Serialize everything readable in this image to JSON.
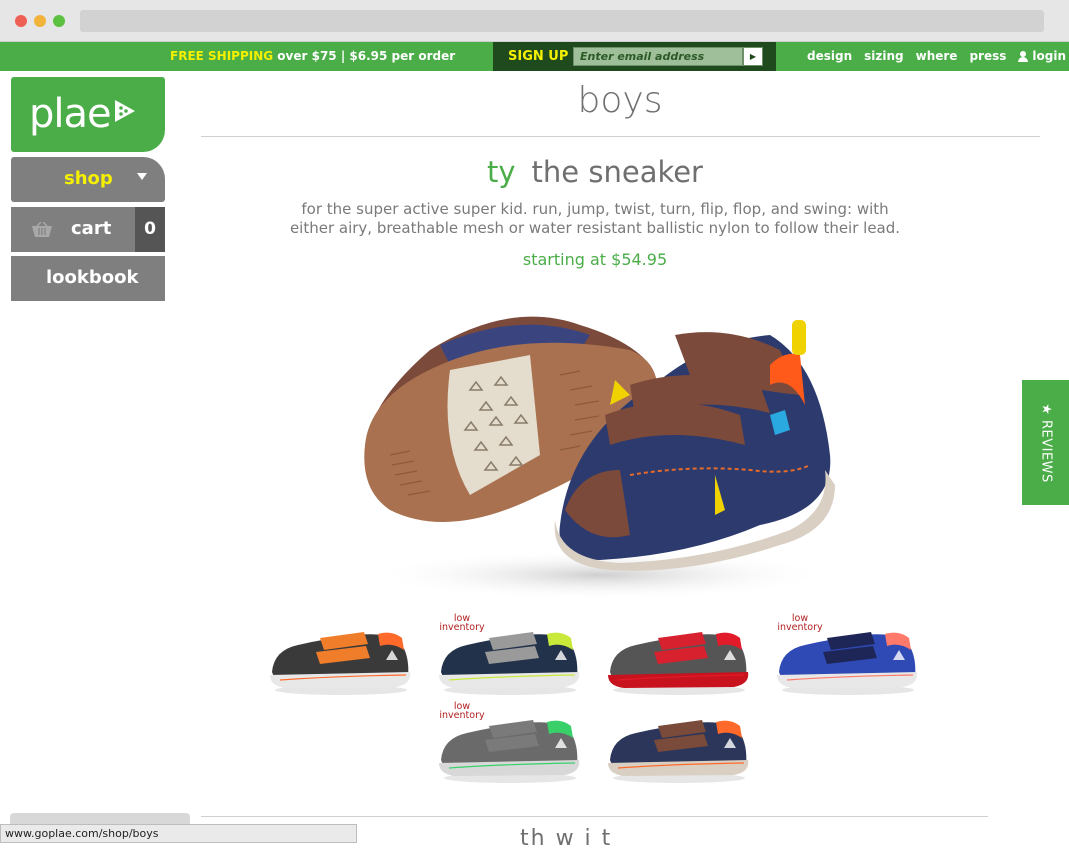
{
  "topbar": {
    "shipping_free": "FREE SHIPPING",
    "shipping_rest": "over $75 | $6.95 per order",
    "signup_label": "SIGN UP",
    "email_placeholder": "Enter email address",
    "nav": [
      "design",
      "sizing",
      "where",
      "press"
    ],
    "login": "login"
  },
  "sidebar": {
    "logo": "plae",
    "shop": "shop",
    "cart": "cart",
    "cart_count": "0",
    "lookbook": "lookbook"
  },
  "main": {
    "title": "boys",
    "product_model": "ty",
    "product_name": "the sneaker",
    "description": "for the super active super kid. run, jump, twist, turn, flip, flop, and swing: with either airy, breathable mesh or water resistant ballistic nylon to follow their lead.",
    "price": "starting at $54.95",
    "low_inventory_label": "low inventory",
    "partial_next_heading": "th  w  i  t"
  },
  "swatches": [
    {
      "name": "black-orange",
      "low_inventory": false,
      "upper": "#3a3a3a",
      "strap": "#f07d2a",
      "sole": "#e8e8e8",
      "accent": "#ff6a2a"
    },
    {
      "name": "gray-navy",
      "low_inventory": true,
      "upper": "#22324a",
      "strap": "#9a9a9a",
      "sole": "#e8e8e8",
      "accent": "#c8e83a"
    },
    {
      "name": "red-gray",
      "low_inventory": false,
      "upper": "#555555",
      "strap": "#d8212e",
      "sole": "#c8121d",
      "accent": "#e21b2b"
    },
    {
      "name": "blue-navy",
      "low_inventory": true,
      "upper": "#2f49b5",
      "strap": "#1d2656",
      "sole": "#e8e8e8",
      "accent": "#ff7a6a"
    },
    {
      "name": "gray-green",
      "low_inventory": true,
      "upper": "#6a6a6a",
      "strap": "#7a7a7a",
      "sole": "#d8d8d8",
      "accent": "#39d06a"
    },
    {
      "name": "brown-navy",
      "low_inventory": false,
      "upper": "#2c355a",
      "strap": "#7a4a3a",
      "sole": "#d9cfc3",
      "accent": "#ff6a2a"
    }
  ],
  "reviews_tab": "★ REVIEWS",
  "status_url": "www.goplae.com/shop/boys",
  "colors": {
    "brand_green": "#4aad48",
    "signup_dark": "#1f4a1e",
    "highlight_yellow": "#f5f000",
    "sidebar_gray": "#7f7f7f",
    "low_inventory_red": "#b22020"
  }
}
